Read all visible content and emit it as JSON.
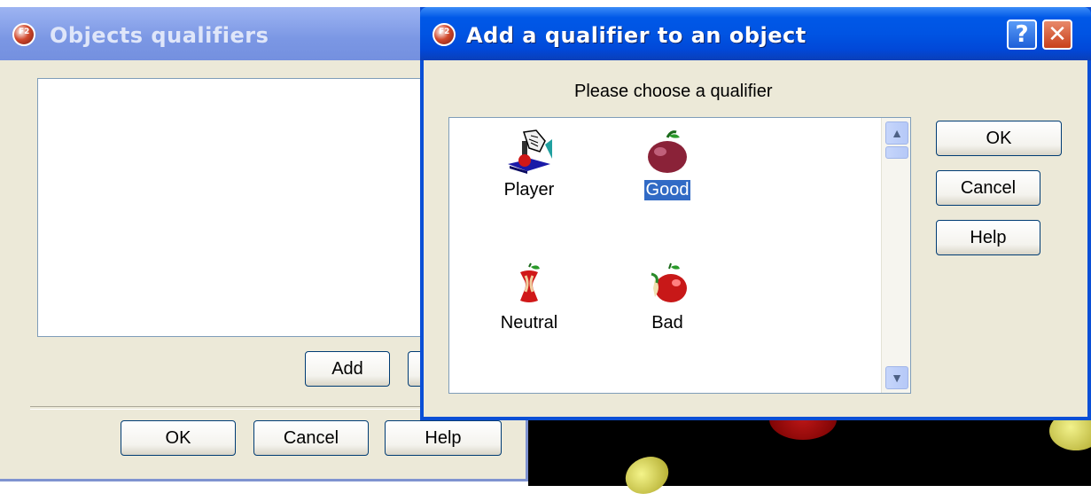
{
  "background_dialog": {
    "title": "Objects qualifiers",
    "add_label": "Add",
    "ok_label": "OK",
    "cancel_label": "Cancel",
    "help_label": "Help"
  },
  "dialog": {
    "title": "Add a qualifier to an object",
    "help_glyph": "?",
    "close_glyph": "✕",
    "prompt": "Please choose a qualifier",
    "ok_label": "OK",
    "cancel_label": "Cancel",
    "help_label": "Help",
    "qualifiers": [
      {
        "label": "Player",
        "icon": "joystick-icon",
        "selected": false
      },
      {
        "label": "Good",
        "icon": "whole-apple-icon",
        "selected": true
      },
      {
        "label": "Neutral",
        "icon": "apple-core-icon",
        "selected": false
      },
      {
        "label": "Bad",
        "icon": "bitten-apple-icon",
        "selected": false
      }
    ]
  },
  "colors": {
    "selection": "#316ac5",
    "titlebar_active": "#0054e3",
    "titlebar_inactive": "#7b97e4",
    "dialog_face": "#ece9d8"
  }
}
